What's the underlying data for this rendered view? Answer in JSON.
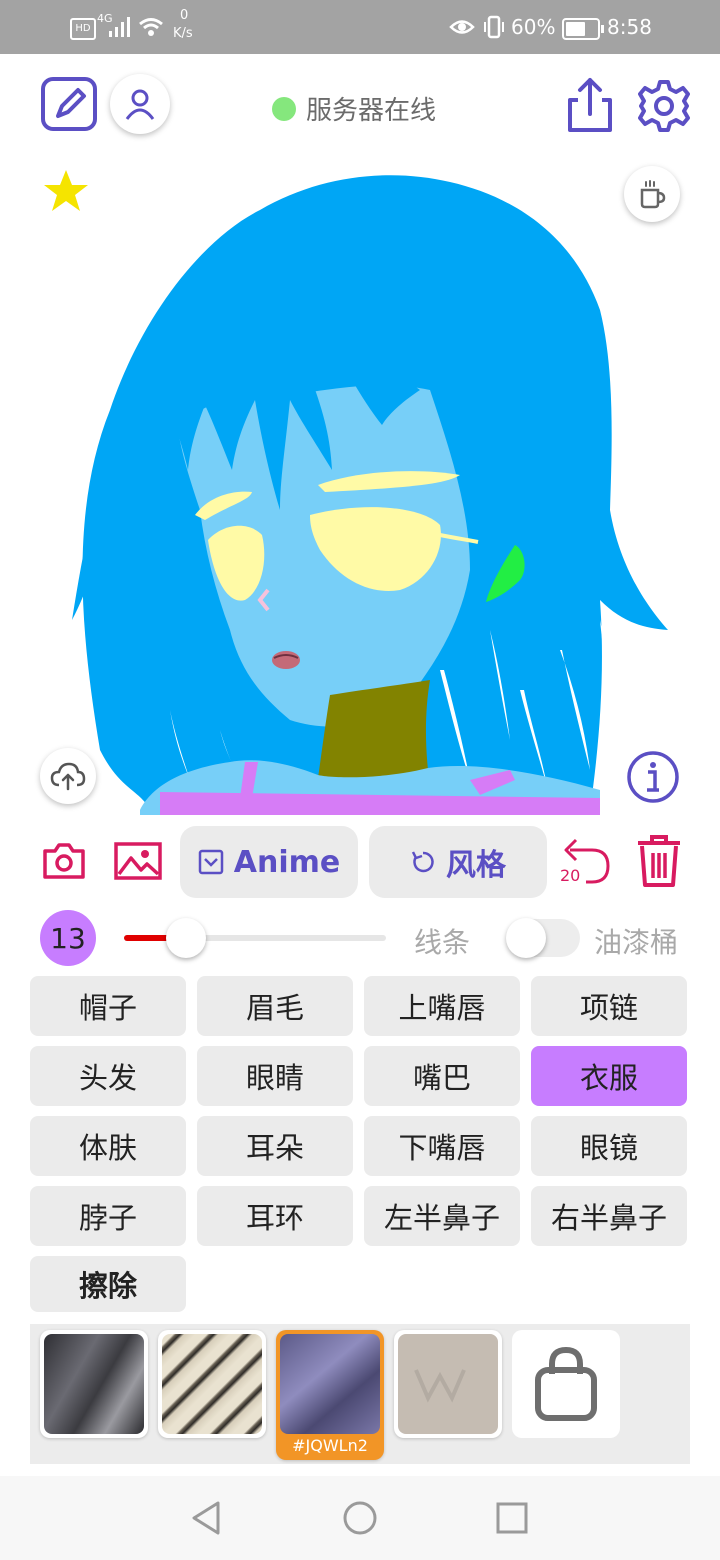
{
  "status_bar": {
    "network": "4G",
    "speed_value": "0",
    "speed_unit": "K/s",
    "battery": "60%",
    "time": "8:58"
  },
  "toolbar": {
    "server_status": "服务器在线",
    "status_color": "#85e77d"
  },
  "actions": {
    "style_button": "Anime",
    "reroll_button": "风格",
    "undo_count": "20"
  },
  "brush": {
    "size": "13",
    "size_fraction": 0.2,
    "mode_line": "线条",
    "mode_bucket": "油漆桶",
    "bucket_on": false
  },
  "parts": {
    "items": [
      "帽子",
      "眉毛",
      "上嘴唇",
      "项链",
      "头发",
      "眼睛",
      "嘴巴",
      "衣服",
      "体肤",
      "耳朵",
      "下嘴唇",
      "眼镜",
      "脖子",
      "耳环",
      "左半鼻子",
      "右半鼻子",
      "擦除"
    ],
    "selected": "衣服"
  },
  "textures": {
    "selected_label": "#JQWLn2"
  },
  "colors": {
    "accent": "#5b4fc4",
    "danger": "#d81b60",
    "selected": "#c77dff",
    "hair": "#00a6f5",
    "skin": "#77cff8"
  }
}
